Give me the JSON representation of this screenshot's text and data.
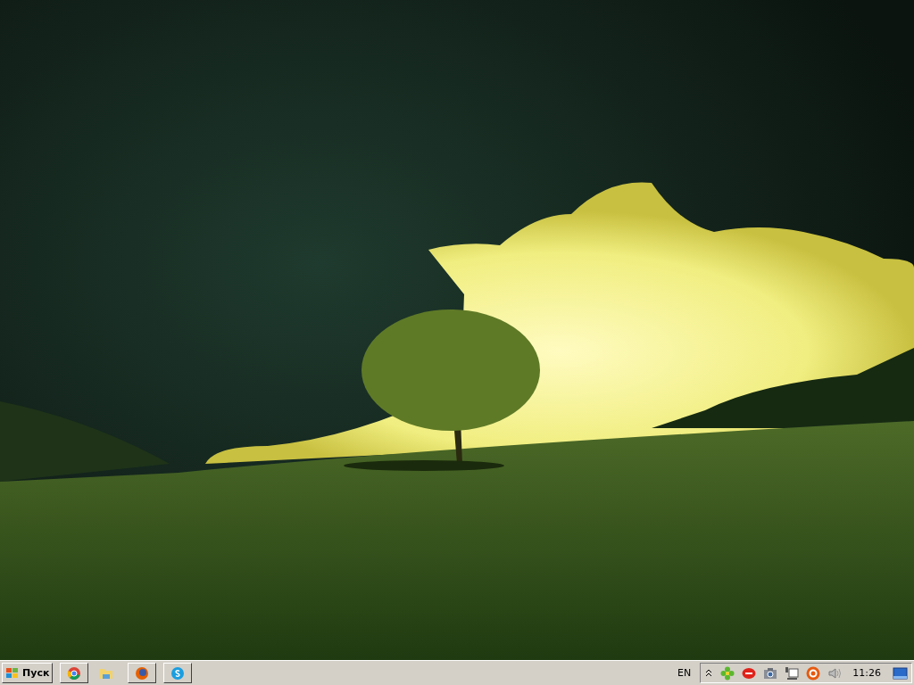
{
  "taskbar": {
    "start_button": {
      "label": "Пуск"
    },
    "language": "EN",
    "clock": "11:26"
  }
}
